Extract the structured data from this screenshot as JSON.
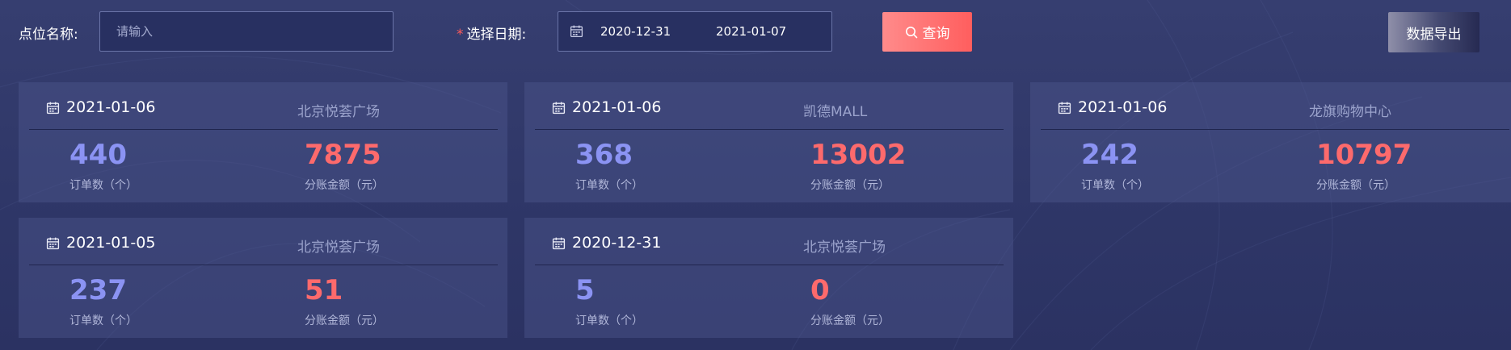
{
  "filters": {
    "name_label": "点位名称:",
    "name_placeholder": "请输入",
    "date_required_mark": "*",
    "date_label": "选择日期:",
    "date_start": "2020-12-31",
    "date_end": "2021-01-07",
    "query_label": "查询",
    "export_label": "数据导出"
  },
  "colors": {
    "orders_accent": "#8b93f3",
    "amount_accent": "#fd6a6c",
    "query_button": "#ff6b6b"
  },
  "icons": {
    "card_date": "calendar-icon",
    "date_range": "calendar-icon",
    "query": "search-icon"
  },
  "cards": [
    {
      "date": "2021-01-06",
      "place": "北京悦荟广场",
      "orders": "440",
      "orders_label": "订单数（个）",
      "amount": "7875",
      "amount_label": "分账金额（元）"
    },
    {
      "date": "2021-01-06",
      "place": "凯德MALL",
      "orders": "368",
      "orders_label": "订单数（个）",
      "amount": "13002",
      "amount_label": "分账金额（元）"
    },
    {
      "date": "2021-01-06",
      "place": "龙旗购物中心",
      "orders": "242",
      "orders_label": "订单数（个）",
      "amount": "10797",
      "amount_label": "分账金额（元）"
    },
    {
      "date": "2021-01-05",
      "place": "北京悦荟广场",
      "orders": "237",
      "orders_label": "订单数（个）",
      "amount": "51",
      "amount_label": "分账金额（元）"
    },
    {
      "date": "2020-12-31",
      "place": "北京悦荟广场",
      "orders": "5",
      "orders_label": "订单数（个）",
      "amount": "0",
      "amount_label": "分账金额（元）"
    }
  ]
}
